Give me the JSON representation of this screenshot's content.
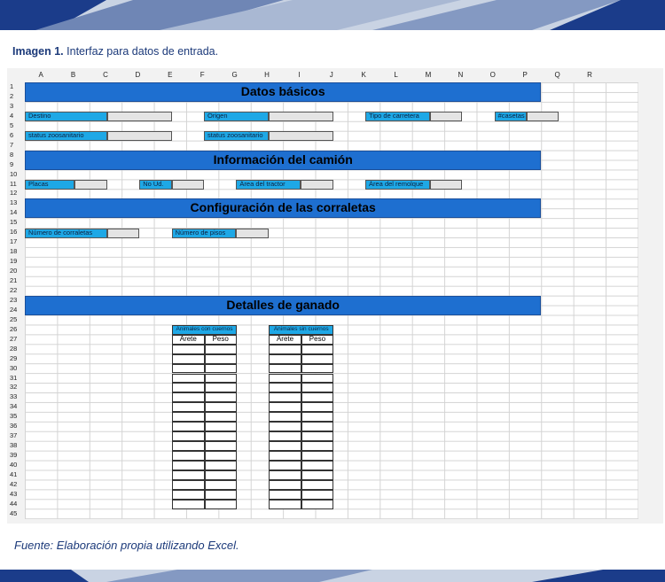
{
  "caption": {
    "prefix": "Imagen 1.",
    "text": " Interfaz para datos de entrada."
  },
  "source": "Fuente: Elaboración propia utilizando Excel.",
  "columns": [
    "A",
    "B",
    "C",
    "D",
    "E",
    "F",
    "G",
    "H",
    "I",
    "J",
    "K",
    "L",
    "M",
    "N",
    "O",
    "P",
    "Q",
    "R"
  ],
  "sections": {
    "basic": "Datos básicos",
    "truck": "Información del camión",
    "config": "Configuración de las corraletas",
    "cattle": "Detalles de ganado"
  },
  "fields": {
    "destino": {
      "label": "Destino",
      "value": ""
    },
    "origen": {
      "label": "Origen",
      "value": ""
    },
    "tipo_carretera": {
      "label": "Tipo de carretera",
      "value": ""
    },
    "casetas": {
      "label": "#casetas",
      "value": ""
    },
    "status_zoo_1": {
      "label": "status zoosanitario",
      "value": ""
    },
    "status_zoo_2": {
      "label": "status zoosanitario",
      "value": ""
    },
    "placas": {
      "label": "Placas",
      "value": ""
    },
    "no_ud": {
      "label": "No Ud.",
      "value": ""
    },
    "area_tractor": {
      "label": "Área del tractor",
      "value": ""
    },
    "area_remolque": {
      "label": "Área del remolque",
      "value": ""
    },
    "num_corraletas": {
      "label": "Número de corraletas",
      "value": ""
    },
    "num_pisos": {
      "label": "Número de pisos",
      "value": ""
    }
  },
  "tables": {
    "con_cuernos": {
      "title": "Animales con cuernos",
      "col1": "Arete",
      "col2": "Peso"
    },
    "sin_cuernos": {
      "title": "Animales sin cuernos",
      "col1": "Arete",
      "col2": "Peso"
    }
  }
}
